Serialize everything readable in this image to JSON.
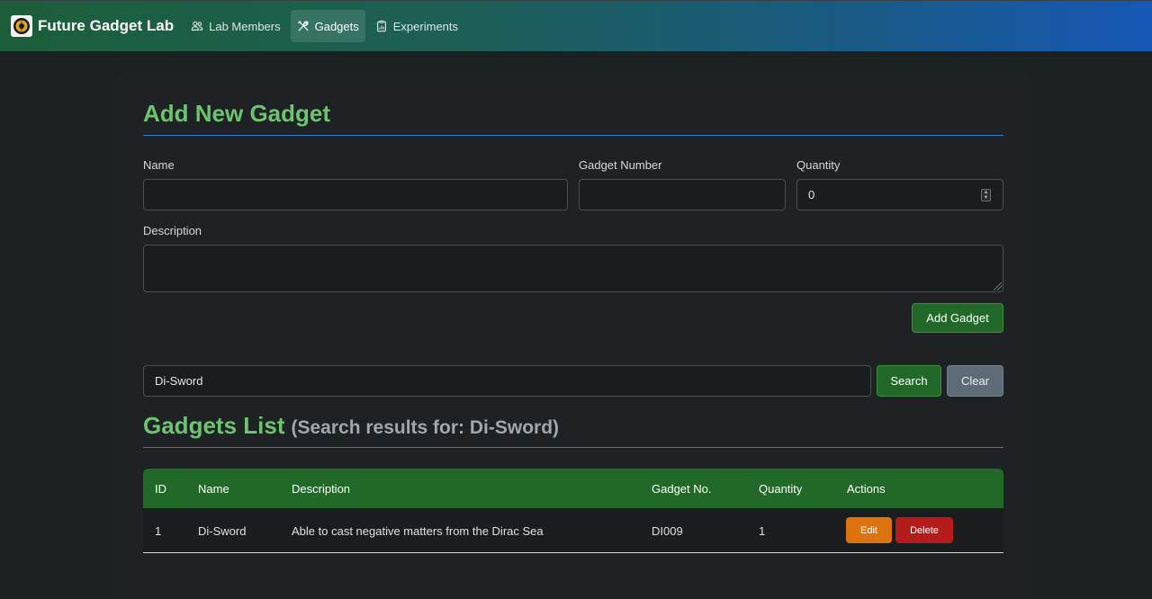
{
  "navbar": {
    "brand": "Future Gadget Lab",
    "links": [
      {
        "label": "Lab Members",
        "icon": "users-icon",
        "active": false
      },
      {
        "label": "Gadgets",
        "icon": "tools-icon",
        "active": true
      },
      {
        "label": "Experiments",
        "icon": "clipboard-icon",
        "active": false
      }
    ]
  },
  "form": {
    "title": "Add New Gadget",
    "name_label": "Name",
    "name_value": "",
    "gadget_number_label": "Gadget Number",
    "gadget_number_value": "",
    "quantity_label": "Quantity",
    "quantity_value": "0",
    "description_label": "Description",
    "description_value": "",
    "submit_label": "Add Gadget"
  },
  "search": {
    "value": "Di-Sword",
    "search_label": "Search",
    "clear_label": "Clear"
  },
  "list": {
    "title": "Gadgets List",
    "subtitle": "(Search results for: Di-Sword)",
    "columns": [
      "ID",
      "Name",
      "Description",
      "Gadget No.",
      "Quantity",
      "Actions"
    ],
    "rows": [
      {
        "id": "1",
        "name": "Di-Sword",
        "description": "Able to cast negative matters from the Dirac Sea",
        "gadget_no": "DI009",
        "quantity": "1",
        "edit_label": "Edit",
        "delete_label": "Delete"
      }
    ]
  },
  "colors": {
    "accent_green": "#6cc46f",
    "button_green": "#226828",
    "edit_orange": "#db7410",
    "delete_red": "#b41c1c",
    "rule_blue": "#2f7fc6"
  }
}
